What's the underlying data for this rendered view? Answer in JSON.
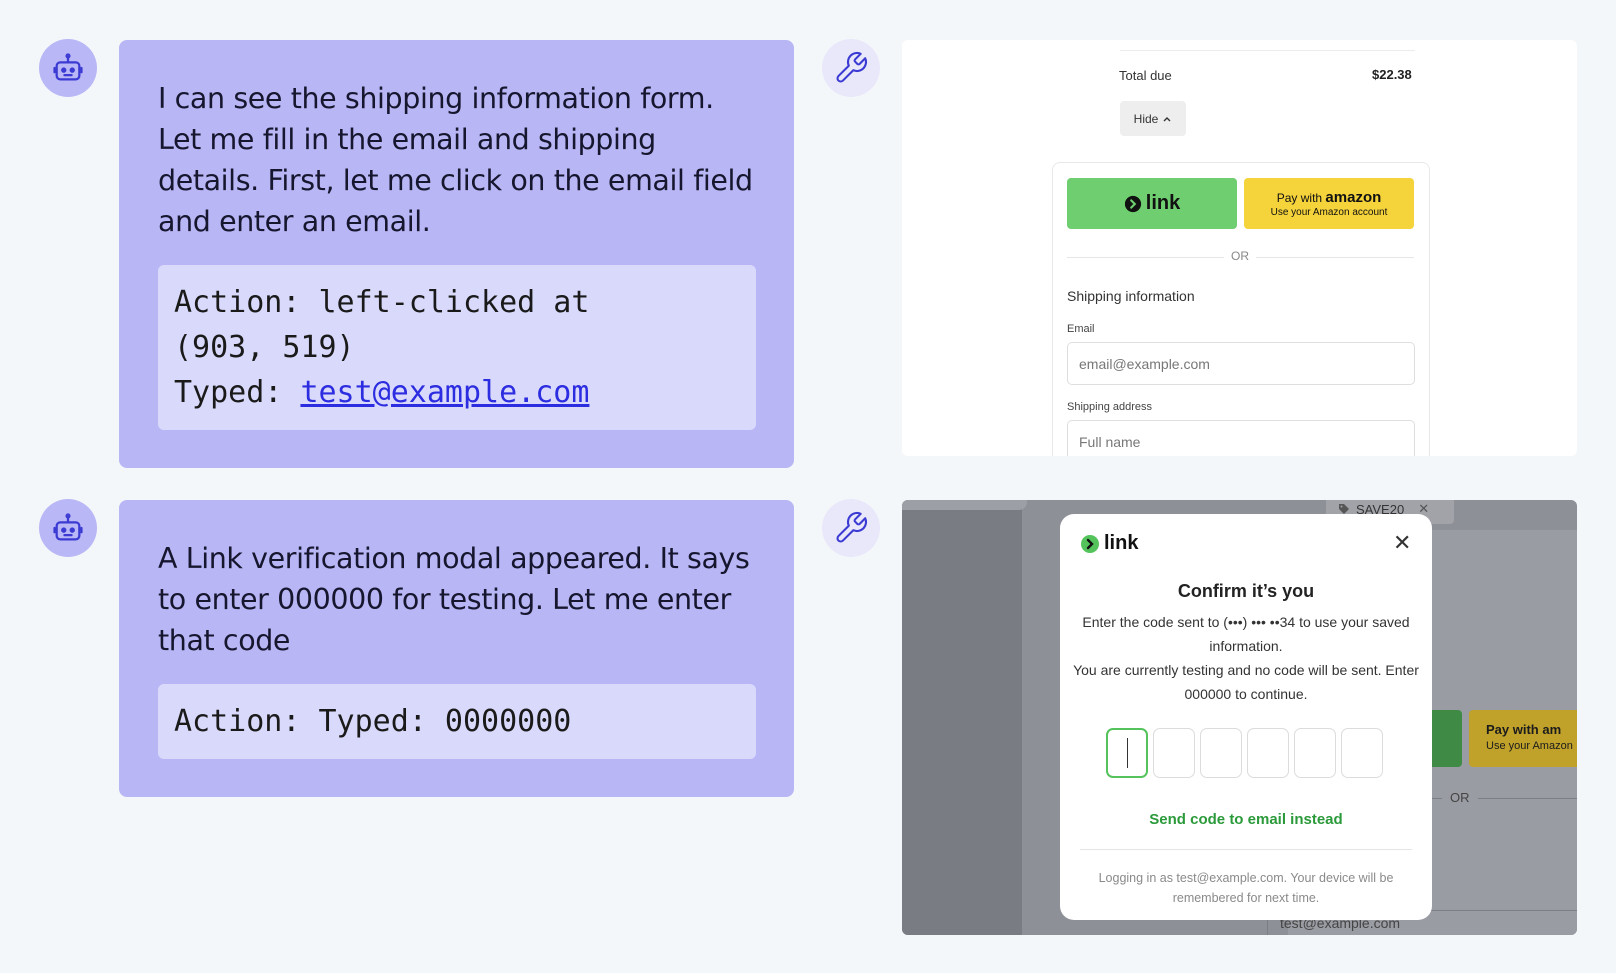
{
  "messages": [
    {
      "text": "I can see the shipping information form. Let me fill in the email and shipping details. First, let me click on the email field and enter an email.",
      "action_line1": "Action: left-clicked at",
      "action_line2": "(903, 519)",
      "action_typed_label": "Typed:",
      "action_typed_value": "test@example.com"
    },
    {
      "text": "A Link verification modal appeared. It says to enter 000000 for testing. Let me enter that code",
      "action_line1": "Action: Typed: 0000000"
    }
  ],
  "icons": {
    "assistant": "robot-icon",
    "tool": "wrench-icon"
  },
  "colors": {
    "bubble": "#b8b6f5",
    "action_box": "#d9dafb",
    "link_green": "#6fcf70",
    "amazon_yellow": "#f5d33a",
    "send_code_green": "#2b9a3a"
  },
  "screenshot1": {
    "total_label": "Total due",
    "total_value": "$22.38",
    "hide_label": "Hide",
    "link_label": "link",
    "amazon_line1": "Pay with",
    "amazon_brand": "amazon",
    "amazon_line2": "Use your Amazon account",
    "or_label": "OR",
    "shipping_title": "Shipping information",
    "email_label": "Email",
    "email_placeholder": "email@example.com",
    "address_label": "Shipping address",
    "fullname_placeholder": "Full name"
  },
  "screenshot2": {
    "coupon_code": "SAVE20",
    "amazon_peek_line1": "Pay with am",
    "amazon_peek_line2": "Use your Amazon",
    "or_label": "OR",
    "input_peek_value": "test@example.com",
    "modal": {
      "brand": "link",
      "title": "Confirm it’s you",
      "body_line1": "Enter the code sent to (•••) ••• ••34 to use your saved information.",
      "body_line2": "You are currently testing and no code will be sent. Enter 000000 to continue.",
      "send_code_label": "Send code to email instead",
      "footer": "Logging in as test@example.com. Your device will be remembered for next time."
    }
  }
}
